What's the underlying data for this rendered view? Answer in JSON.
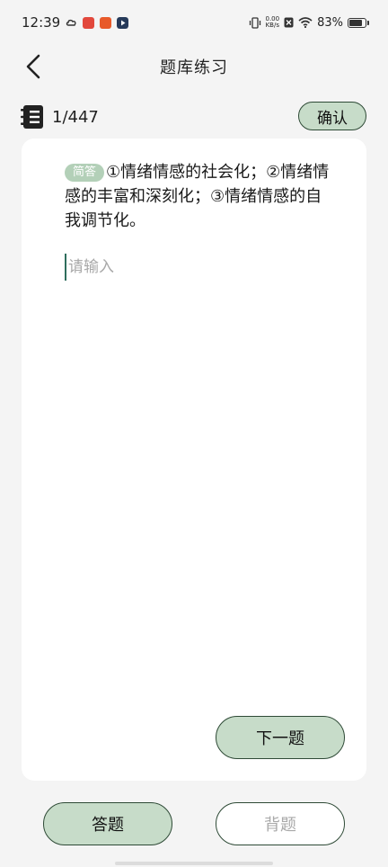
{
  "status_bar": {
    "time": "12:39",
    "net_speed_value": "0.00",
    "net_speed_unit": "KB/s",
    "battery_percent": "83%",
    "battery_level": 0.83
  },
  "header": {
    "title": "题库练习"
  },
  "progress": {
    "text": "1/447",
    "confirm_label": "确认"
  },
  "question": {
    "type_tag": "简答",
    "text": "①情绪情感的社会化；②情绪情感的丰富和深刻化；③情绪情感的自我调节化。"
  },
  "answer": {
    "value": "",
    "placeholder": "请输入"
  },
  "actions": {
    "next_label": "下一题"
  },
  "modes": {
    "answer_label": "答题",
    "recite_label": "背题"
  },
  "colors": {
    "accent": "#c7dcc9",
    "accent_border": "#2e4a36",
    "tag": "#b3d0b8",
    "page_bg": "#f4f4f4",
    "card_bg": "#ffffff"
  }
}
